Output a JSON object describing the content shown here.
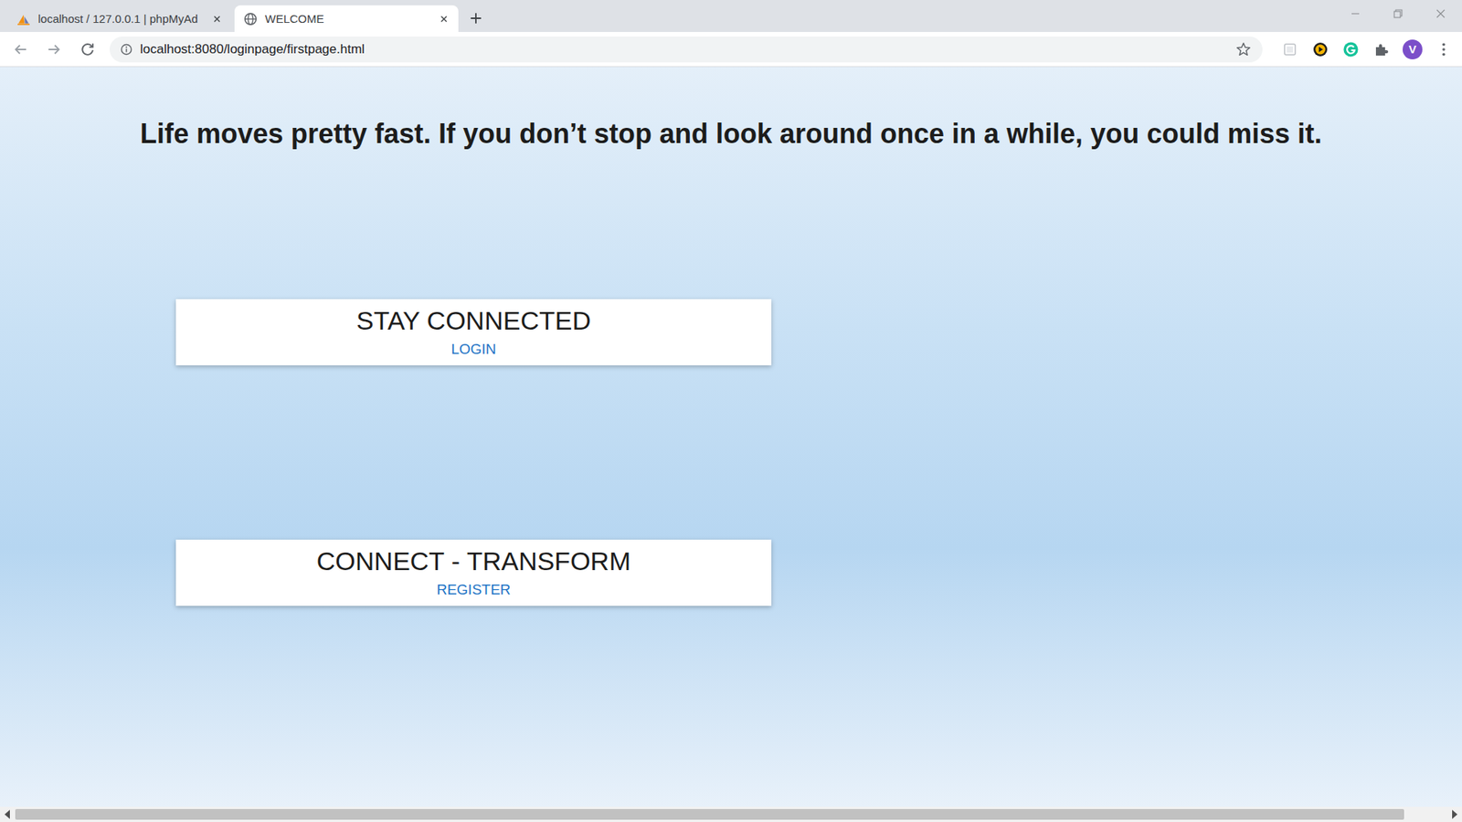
{
  "tabs": [
    {
      "label": "localhost / 127.0.0.1 | phpMyAd",
      "selected": false,
      "favicon": "phpmyadmin"
    },
    {
      "label": "WELCOME",
      "selected": true,
      "favicon": "globe"
    }
  ],
  "address_bar": {
    "url": "localhost:8080/loginpage/firstpage.html"
  },
  "profile": {
    "initial": "V"
  },
  "page": {
    "heading": "Life moves pretty fast. If you don’t stop and look around once in a while, you could miss it.",
    "cards": [
      {
        "title": "STAY CONNECTED",
        "link": "LOGIN"
      },
      {
        "title": "CONNECT - TRANSFORM",
        "link": "REGISTER"
      }
    ]
  },
  "horizontal_scrollbar": {
    "level": 0.97
  }
}
